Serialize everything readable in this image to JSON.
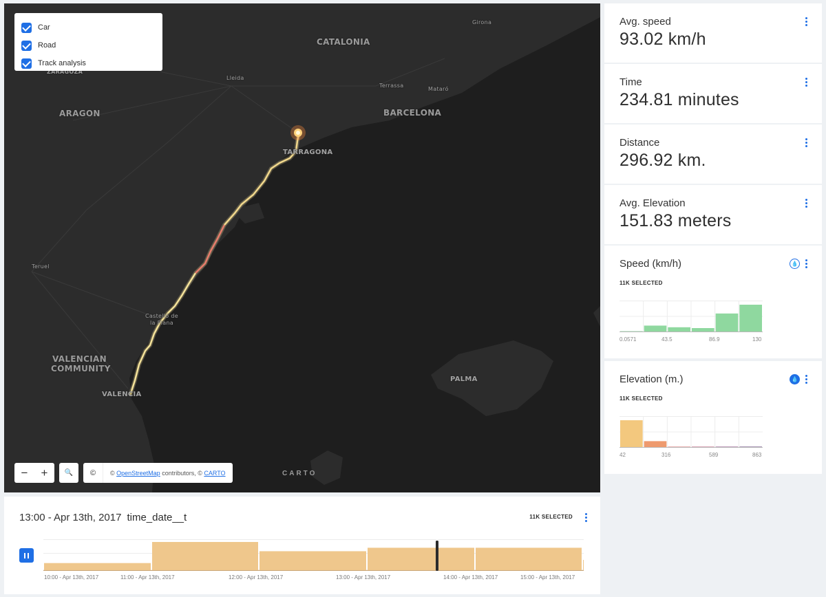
{
  "map": {
    "layers": [
      {
        "label": "Car",
        "checked": true
      },
      {
        "label": "Road",
        "checked": true
      },
      {
        "label": "Track analysis",
        "checked": true
      }
    ],
    "labels": {
      "catalonia": "CATALONIA",
      "aragon": "ARAGON",
      "zaragoza": "ZARAGOZA",
      "barcelona": "BARCELONA",
      "tarragona": "TARRAGONA",
      "lleida": "Lleida",
      "terrassa": "Terrassa",
      "mataro": "Mataró",
      "girona": "Girona",
      "teruel": "Teruel",
      "castello": "Castelló de la Plana",
      "valencian1": "VALENCIAN",
      "valencian2": "COMMUNITY",
      "valencia": "VALENCIA",
      "palma": "PALMA"
    },
    "controls": {
      "zoom_out": "−",
      "zoom_in": "+",
      "search": "🔍",
      "info": "©"
    },
    "attribution": {
      "prefix": "©",
      "osm": "OpenStreetMap",
      "middle": " contributors, ©",
      "carto": "CARTO"
    },
    "carto_logo": "CARTO"
  },
  "widgets": {
    "avg_speed": {
      "title": "Avg. speed",
      "value": "93.02 km/h"
    },
    "time": {
      "title": "Time",
      "value": "234.81 minutes"
    },
    "distance": {
      "title": "Distance",
      "value": "296.92 km."
    },
    "avg_elevation": {
      "title": "Avg. Elevation",
      "value": "151.83 meters"
    },
    "speed_hist": {
      "title": "Speed (km/h)",
      "selected": "11K SELECTED",
      "ticks": [
        "0.0571",
        "43.5",
        "86.9",
        "130"
      ],
      "bins": [
        0.03,
        0.24,
        0.18,
        0.15,
        0.68,
        1.0
      ],
      "color": "#8fd89f"
    },
    "elevation_hist": {
      "title": "Elevation (m.)",
      "selected": "11K SELECTED",
      "ticks": [
        "42",
        "316",
        "589",
        "863"
      ],
      "bins": [
        1.0,
        0.24,
        0.03,
        0.02,
        0.02,
        0.03
      ],
      "colors": [
        "#f3c87e",
        "#ee9a6e",
        "#d86b6b",
        "#b85476",
        "#8a437d",
        "#5a3572"
      ]
    }
  },
  "timeline": {
    "header_time": "13:00 - Apr 13th, 2017",
    "column": "time_date__t",
    "selected": "11K SELECTED",
    "labels": [
      "10:00 - Apr 13th, 2017",
      "11:00 - Apr 13th, 2017",
      "12:00 - Apr 13th, 2017",
      "13:00 - Apr 13th, 2017",
      "14:00 - Apr 13th, 2017",
      "15:00 - Apr 13th, 2017"
    ],
    "bins": [
      0.27,
      1.0,
      0.68,
      0.8,
      0.8,
      0.38
    ],
    "color": "#efc78c"
  }
}
